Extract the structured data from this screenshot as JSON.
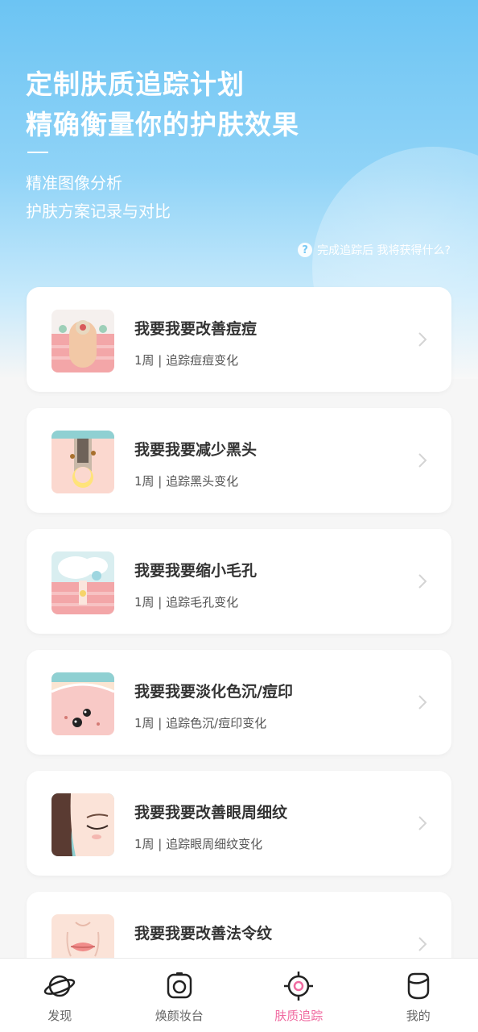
{
  "hero": {
    "title_line1": "定制肤质追踪计划",
    "title_line2": "精确衡量你的护肤效果",
    "sub_line1": "精准图像分析",
    "sub_line2": "护肤方案记录与对比",
    "help_icon": "?",
    "help_text": "完成追踪后 我将获得什么?"
  },
  "plans": [
    {
      "title": "我要我要改善痘痘",
      "meta": "1周 | 追踪痘痘变化",
      "icon": "acne-illustration"
    },
    {
      "title": "我要我要减少黑头",
      "meta": "1周 | 追踪黑头变化",
      "icon": "blackhead-illustration"
    },
    {
      "title": "我要我要缩小毛孔",
      "meta": "1周 | 追踪毛孔变化",
      "icon": "pore-illustration"
    },
    {
      "title": "我要我要淡化色沉/痘印",
      "meta": "1周 | 追踪色沉/痘印变化",
      "icon": "pigmentation-illustration"
    },
    {
      "title": "我要我要改善眼周细纹",
      "meta": "1周 | 追踪眼周细纹变化",
      "icon": "eye-wrinkle-illustration"
    },
    {
      "title": "我要我要改善法令纹",
      "meta": "",
      "icon": "nasolabial-illustration"
    }
  ],
  "tabs": [
    {
      "label": "发现",
      "icon": "planet-icon",
      "active": false
    },
    {
      "label": "焕颜妆台",
      "icon": "camera-icon",
      "active": false
    },
    {
      "label": "肤质追踪",
      "icon": "target-icon",
      "active": true
    },
    {
      "label": "我的",
      "icon": "face-icon",
      "active": false
    }
  ],
  "colors": {
    "accent": "#f06aa0",
    "hero_blue": "#6cc4f3"
  }
}
